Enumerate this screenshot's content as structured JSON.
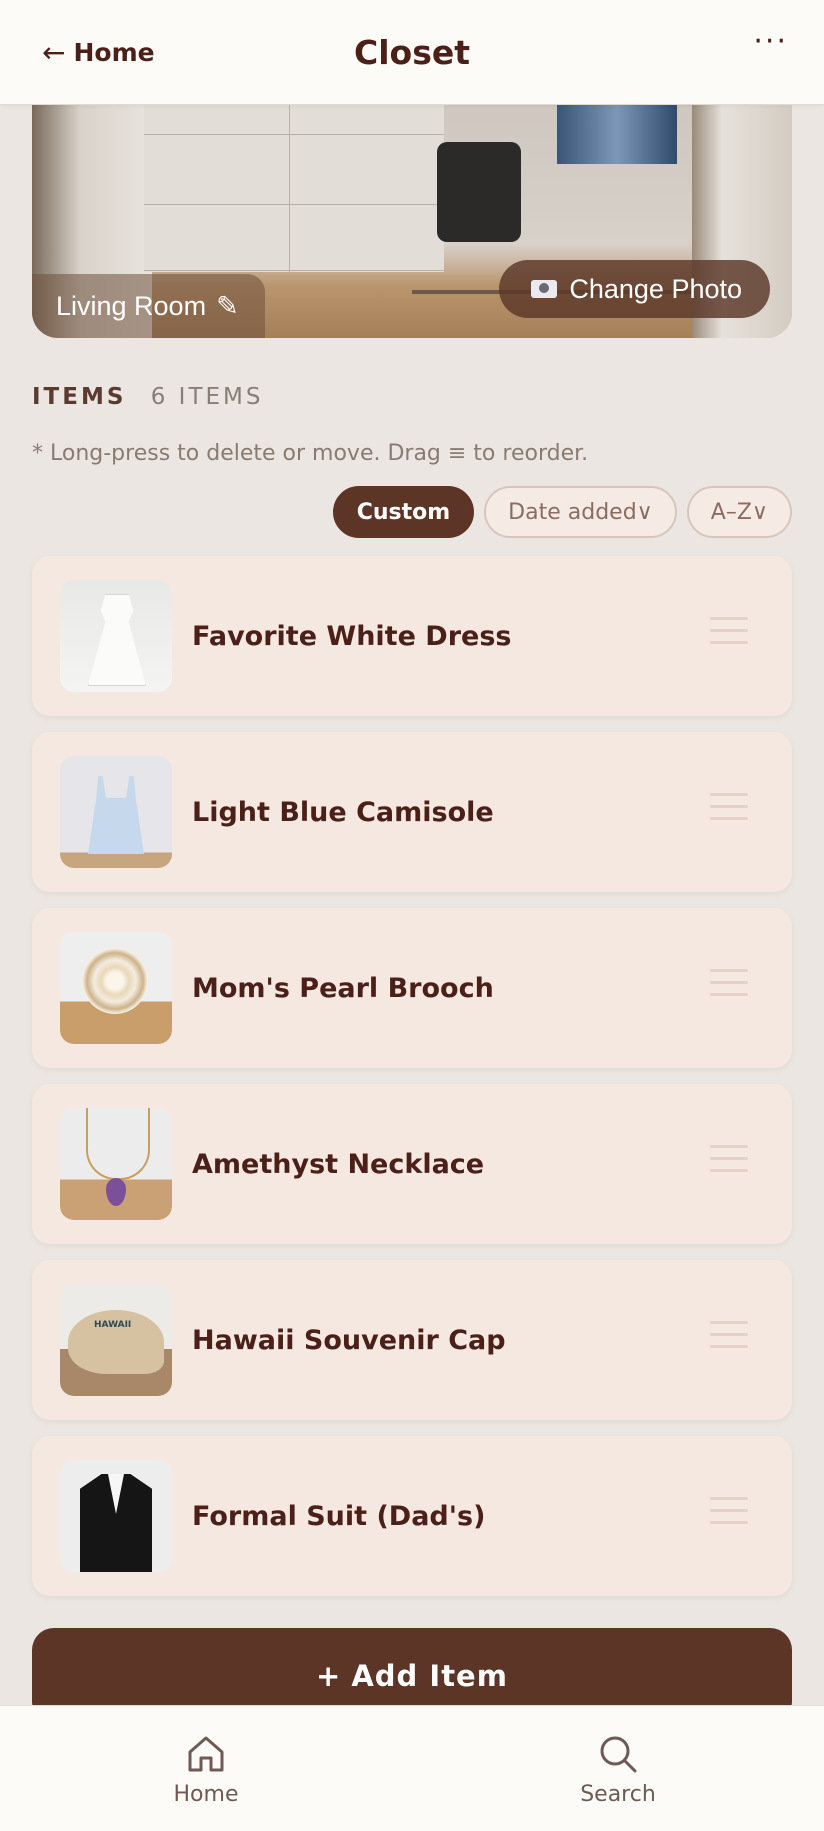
{
  "header": {
    "back_arrow": "←",
    "back_label": "Home",
    "title": "Closet",
    "more": "···"
  },
  "hero": {
    "room_label": "Living Room",
    "edit_icon": "✎",
    "change_photo_label": "Change Photo"
  },
  "items_section": {
    "label": "ITEMS",
    "count": "6 ITEMS",
    "hint": "* Long-press to delete or move. Drag ≡ to reorder."
  },
  "sort_options": [
    {
      "label": "Custom",
      "active": true
    },
    {
      "label": "Date added∨",
      "active": false
    },
    {
      "label": "A–Z∨",
      "active": false
    }
  ],
  "items": [
    {
      "name": "Favorite White Dress"
    },
    {
      "name": "Light Blue Camisole"
    },
    {
      "name": "Mom's Pearl Brooch"
    },
    {
      "name": "Amethyst Necklace"
    },
    {
      "name": "Hawaii Souvenir Cap"
    },
    {
      "name": "Formal Suit (Dad's)"
    }
  ],
  "add_item": {
    "plus": "+",
    "label": "Add Item"
  },
  "bottom_nav": {
    "home_label": "Home",
    "search_label": "Search"
  },
  "thumb_text": {
    "cap": "HAWAII"
  },
  "colors": {
    "brand_brown": "#5d3526",
    "card_bg": "#f5e8e0",
    "page_bg": "#ebe6e1",
    "text_dark": "#4a2018"
  }
}
